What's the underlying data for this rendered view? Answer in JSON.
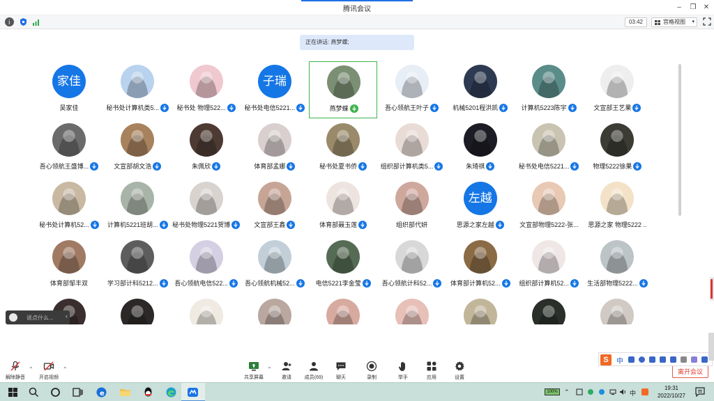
{
  "window": {
    "title": "腾讯会议"
  },
  "toolbar": {
    "timer": "03:42",
    "view_mode": "宫格视图"
  },
  "speaking": "正在讲话: 燕梦蝶;",
  "participants": [
    {
      "name": "吴家佳",
      "avatar_text": "家佳",
      "mic": false,
      "bg": "#1576e6"
    },
    {
      "name": "秘书处计算机类5...",
      "mic": true,
      "bg": "#b9d2ee"
    },
    {
      "name": "秘书处 物理522...",
      "mic": true,
      "bg": "#f0c8cf"
    },
    {
      "name": "秘书处电信5221...",
      "avatar_text": "子瑞",
      "mic": true,
      "bg": "#1576e6"
    },
    {
      "name": "燕梦蝶",
      "mic": true,
      "speaking": true,
      "bg": "#7a8f73"
    },
    {
      "name": "吾心领航王叶子",
      "mic": true,
      "bg": "#e7eef6"
    },
    {
      "name": "机械5201程洪凯",
      "mic": true,
      "bg": "#2e3a52"
    },
    {
      "name": "计算机5223陈宇",
      "mic": true,
      "bg": "#5a8c8a"
    },
    {
      "name": "文宣部王艺果",
      "mic": true,
      "bg": "#eeeeee"
    },
    {
      "name": "吾心领航王盛博...",
      "mic": true,
      "bg": "#6b6b6b"
    },
    {
      "name": "文宣部胡文浩",
      "mic": true,
      "bg": "#a8825d"
    },
    {
      "name": "朱佩欣",
      "mic": true,
      "bg": "#4d3b33"
    },
    {
      "name": "体育部孟娜",
      "mic": true,
      "bg": "#d9cfcf"
    },
    {
      "name": "秘书处夏书侨",
      "mic": true,
      "bg": "#9a8a6a"
    },
    {
      "name": "组织部计算机类5...",
      "mic": true,
      "bg": "#e9dcd6"
    },
    {
      "name": "朱琦祺",
      "mic": true,
      "bg": "#1c1c24"
    },
    {
      "name": "秘书处电信5221...",
      "mic": true,
      "bg": "#c9c4b1"
    },
    {
      "name": "物理5222徐果",
      "mic": true,
      "bg": "#3c3c34"
    },
    {
      "name": "秘书处计算机52...",
      "mic": true,
      "bg": "#c9b9a3"
    },
    {
      "name": "计算机5221班胡...",
      "mic": true,
      "bg": "#a9b4a8"
    },
    {
      "name": "秘书处物理5221贺博",
      "mic": true,
      "bg": "#d8d3cf"
    },
    {
      "name": "文宣部王鑫",
      "mic": true,
      "bg": "#c7a596"
    },
    {
      "name": "体育部聂玉莲",
      "mic": true,
      "bg": "#ede3df"
    },
    {
      "name": "组织部代妍",
      "mic": false,
      "bg": "#cfa89d"
    },
    {
      "name": "思源之家左越",
      "avatar_text": "左越",
      "mic": true,
      "bg": "#1576e6"
    },
    {
      "name": "文宣部物理5222-张...",
      "mic": false,
      "bg": "#e8c9b4"
    },
    {
      "name": "思源之家 物理5222 ...",
      "mic": false,
      "bg": "#f3e2c7"
    },
    {
      "name": "体育部邹丰双",
      "mic": false,
      "bg": "#a07a63"
    },
    {
      "name": "学习部计科5212...",
      "mic": true,
      "bg": "#5d5d5d"
    },
    {
      "name": "吾心领航电信522...",
      "mic": true,
      "bg": "#d5cfe3"
    },
    {
      "name": "吾心领航机械52...",
      "mic": true,
      "bg": "#c2cfd8"
    },
    {
      "name": "电信5221李金莹",
      "mic": true,
      "bg": "#566b54"
    },
    {
      "name": "吾心领航计科52...",
      "mic": true,
      "bg": "#d8d8d8"
    },
    {
      "name": "体育部计算机52...",
      "mic": true,
      "bg": "#8a6b46"
    },
    {
      "name": "组织部计算机52...",
      "mic": true,
      "bg": "#efe6e6"
    },
    {
      "name": "生活部物理5222...",
      "mic": true,
      "bg": "#bcc4c7"
    },
    {
      "name": "",
      "mic": false,
      "bg": "#3a2e2e"
    },
    {
      "name": "",
      "mic": false,
      "bg": "#2c2828"
    },
    {
      "name": "",
      "mic": false,
      "bg": "#efeae2"
    },
    {
      "name": "",
      "mic": false,
      "bg": "#b9a7a0"
    },
    {
      "name": "",
      "mic": false,
      "bg": "#d7aaa0"
    },
    {
      "name": "",
      "mic": false,
      "bg": "#e7c0b8"
    },
    {
      "name": "",
      "mic": false,
      "bg": "#c2b69a"
    },
    {
      "name": "",
      "mic": false,
      "bg": "#2a2f2a"
    },
    {
      "name": "",
      "mic": false,
      "bg": "#d0c9c4"
    }
  ],
  "chat": {
    "placeholder": "说点什么..."
  },
  "controls": {
    "unmute": "解除静音",
    "start_video": "开启视频",
    "share_screen": "共享屏幕",
    "invite": "邀请",
    "members": "成员(69)",
    "chat": "聊天",
    "record": "录制",
    "raise_hand": "举手",
    "apps": "应用",
    "settings": "设置",
    "leave": "离开会议"
  },
  "ime": {
    "logo": "S",
    "mode": "中"
  },
  "taskbar": {
    "battery": "100%",
    "time": "19:31",
    "date": "2022/10/27"
  },
  "colors": {
    "accent": "#1576e6",
    "speaking_border": "#3db24b",
    "leave": "#e03a2f",
    "taskbar": "#c9dfd9"
  }
}
